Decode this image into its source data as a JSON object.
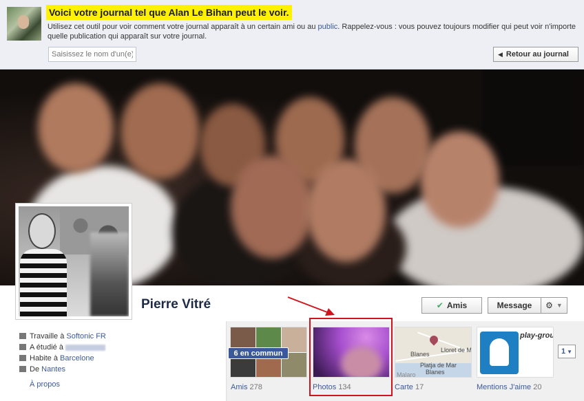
{
  "banner": {
    "headline": "Voici votre journal tel que Alan Le Bihan peut le voir.",
    "explain_before": "Utilisez cet outil pour voir comment votre journal apparaît à un certain ami ou au ",
    "explain_link": "public",
    "explain_after": ". Rappelez-vous : vous pouvez toujours modifier qui peut voir n'importe quelle publication qui apparaît sur votre journal.",
    "friend_input_placeholder": "Saisissez le nom d'un(e) a",
    "back_button": "Retour au journal"
  },
  "profile": {
    "name": "Pierre Vitré",
    "buttons": {
      "friends": "Amis",
      "message": "Message"
    }
  },
  "info": {
    "work_prefix": "Travaille à ",
    "work_link": "Softonic FR",
    "study_prefix": "A étudié à ",
    "lives_prefix": "Habite à ",
    "lives_link": "Barcelone",
    "from_prefix": "De ",
    "from_link": "Nantes",
    "about": "À propos"
  },
  "apps": {
    "friends": {
      "label": "Amis",
      "count": "278",
      "badge": "6 en commun"
    },
    "photos": {
      "label": "Photos",
      "count": "134"
    },
    "map": {
      "label": "Carte",
      "count": "17",
      "place1": "Blanes",
      "place2": "Lloret de M",
      "place3": "Platja de Mar",
      "place4": "Blanes",
      "place5": "Malaro"
    },
    "likes": {
      "label": "Mentions J'aime",
      "count": "20",
      "brand": "play-groun"
    },
    "more": "1"
  },
  "colors": {
    "highlight": "#ffff00",
    "link": "#3b5998",
    "annotation": "#d0131b"
  }
}
